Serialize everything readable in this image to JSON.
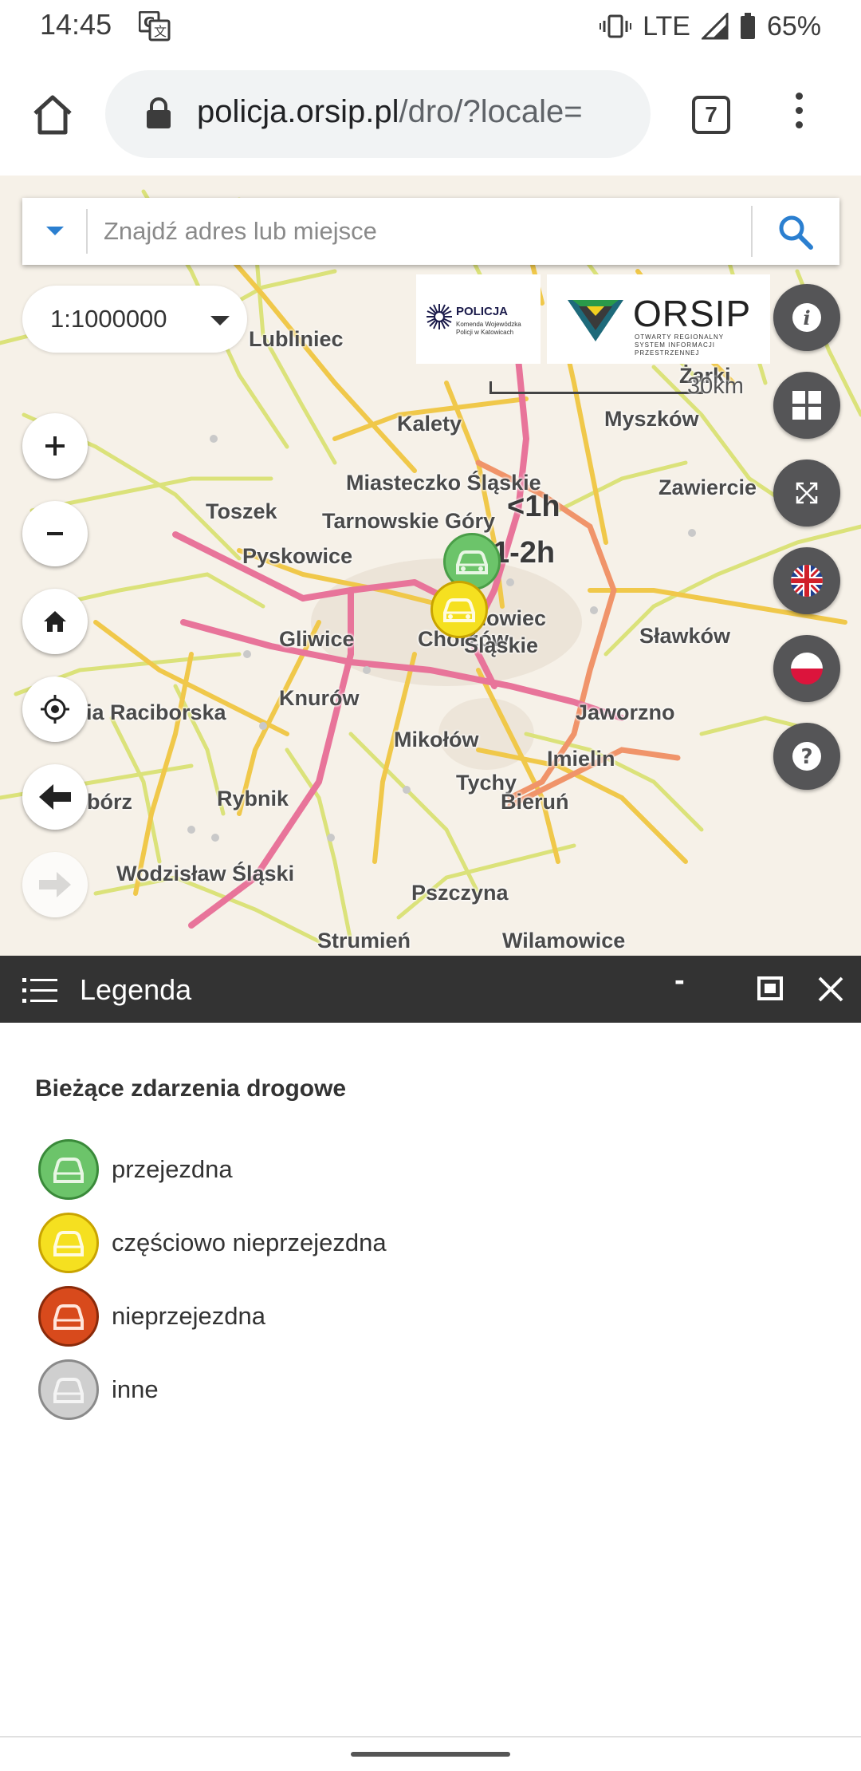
{
  "status_bar": {
    "time": "14:45",
    "network": "LTE",
    "battery": "65%"
  },
  "browser": {
    "url_host": "policja.orsip.pl",
    "url_path": "/dro/?locale=",
    "tab_count": "7"
  },
  "search": {
    "placeholder": "Znajdź adres lub miejsce"
  },
  "map": {
    "scale_select": "1:1000000",
    "scale_bar": "30km",
    "logos": {
      "policja_name": "POLICJA",
      "policja_sub": "Komenda Wojewódzka Policji w Katowicach",
      "orsip_name": "ORSIP",
      "orsip_sub": "OTWARTY REGIONALNY SYSTEM INFORMACJI PRZESTRZENNEJ"
    },
    "time_labels": [
      "<1h",
      "1-2h"
    ],
    "places": [
      "Lubliniec",
      "Kalety",
      "Żarki",
      "Myszków",
      "Miasteczko Śląskie",
      "Zawiercie",
      "Toszek",
      "Tarnowskie Góry",
      "Pyskowice",
      "Sosnowiec",
      "Gliwice",
      "Chorzów",
      "Śląskie",
      "Sławków",
      "Knurów",
      "Kuźnia Raciborska",
      "Jaworzno",
      "Mikołów",
      "Imielin",
      "Tychy",
      "Bieruń",
      "Racibórz",
      "Rybnik",
      "Wodzisław Śląski",
      "Pszczyna",
      "Strumień",
      "Wilamowice"
    ],
    "colors": {
      "motorway": "#e8749a",
      "expressway": "#f0946a",
      "main_road": "#f0d060",
      "minor_road": "#d8e060",
      "marker_green": "#6cc46a",
      "marker_yellow": "#f5e020"
    }
  },
  "legend": {
    "title": "Legenda",
    "minimize": "-",
    "section_title": "Bieżące zdarzenia drogowe",
    "items": [
      {
        "label": "przejezdna",
        "color": "#6cc46a",
        "border": "#3a8a3a"
      },
      {
        "label": "częściowo nieprzejezdna",
        "color": "#f5e020",
        "border": "#c9a400"
      },
      {
        "label": "nieprzejezdna",
        "color": "#d84a1c",
        "border": "#8a2a0a"
      },
      {
        "label": "inne",
        "color": "#cfcfcf",
        "border": "#8a8a8a"
      }
    ]
  }
}
